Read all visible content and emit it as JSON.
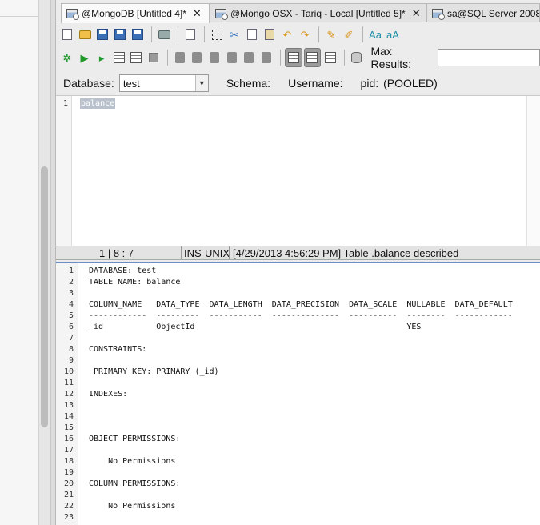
{
  "tabs": [
    {
      "label": "@MongoDB [Untitled 4]*",
      "active": true
    },
    {
      "label": "@Mongo OSX - Tariq - Local [Untitled 5]*",
      "active": false
    },
    {
      "label": "sa@SQL Server 2008 -",
      "active": false
    }
  ],
  "close_glyph": "✕",
  "toolbar": {
    "max_results_label": "Max Results:",
    "max_results_value": ""
  },
  "db_bar": {
    "database_label": "Database:",
    "database_value": "test",
    "schema_label": "Schema:",
    "username_label": "Username:",
    "pid_label": "pid:",
    "pid_value": "(POOLED)"
  },
  "sql_editor": {
    "line_number": "1",
    "text": "balance"
  },
  "status": {
    "position": "1 | 8 : 7",
    "ins": "INS",
    "unix": "UNIX",
    "message": "[4/29/2013 4:56:29 PM] Table .balance described"
  },
  "results_lines": [
    {
      "n": "1",
      "t": "DATABASE: test"
    },
    {
      "n": "2",
      "t": "TABLE NAME: balance"
    },
    {
      "n": "3",
      "t": ""
    },
    {
      "n": "4",
      "t": "COLUMN_NAME   DATA_TYPE  DATA_LENGTH  DATA_PRECISION  DATA_SCALE  NULLABLE  DATA_DEFAULT"
    },
    {
      "n": "5",
      "t": "------------  ---------  -----------  --------------  ----------  --------  ------------"
    },
    {
      "n": "6",
      "t": "_id           ObjectId                                            YES"
    },
    {
      "n": "7",
      "t": ""
    },
    {
      "n": "8",
      "t": "CONSTRAINTS:"
    },
    {
      "n": "9",
      "t": ""
    },
    {
      "n": "10",
      "t": " PRIMARY KEY: PRIMARY (_id)"
    },
    {
      "n": "11",
      "t": ""
    },
    {
      "n": "12",
      "t": "INDEXES:"
    },
    {
      "n": "13",
      "t": ""
    },
    {
      "n": "14",
      "t": ""
    },
    {
      "n": "15",
      "t": ""
    },
    {
      "n": "16",
      "t": "OBJECT PERMISSIONS:"
    },
    {
      "n": "17",
      "t": ""
    },
    {
      "n": "18",
      "t": "    No Permissions"
    },
    {
      "n": "19",
      "t": ""
    },
    {
      "n": "20",
      "t": "COLUMN PERMISSIONS:"
    },
    {
      "n": "21",
      "t": ""
    },
    {
      "n": "22",
      "t": "    No Permissions"
    },
    {
      "n": "23",
      "t": ""
    }
  ]
}
